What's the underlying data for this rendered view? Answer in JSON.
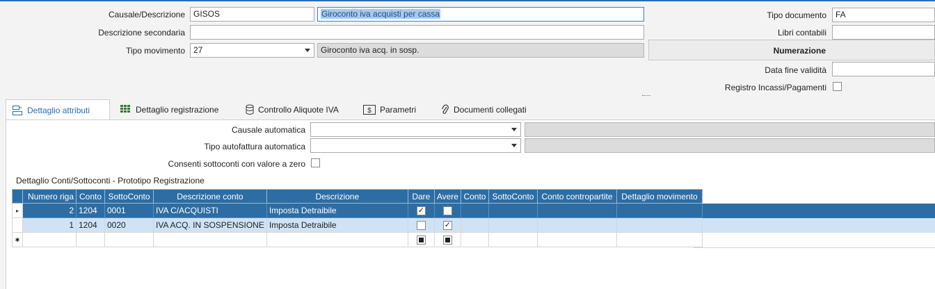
{
  "header": {
    "causale_label": "Causale/Descrizione",
    "causale_code": "GISOS",
    "causale_desc": "Giroconto iva acquisti per cassa",
    "desc_secondaria_label": "Descrizione secondaria",
    "desc_secondaria_value": "",
    "tipo_movimento_label": "Tipo movimento",
    "tipo_movimento_code": "27",
    "tipo_movimento_desc": "Giroconto iva acq. in sosp.",
    "tipo_documento_label": "Tipo documento",
    "tipo_documento_value": "FA",
    "libri_contabili_label": "Libri contabili",
    "libri_contabili_value": "",
    "numerazione_label": "Numerazione",
    "data_fine_label": "Data fine validità",
    "data_fine_value": "",
    "registro_label": "Registro Incassi/Pagamenti"
  },
  "tabs": [
    {
      "label": "Dettaglio attributi",
      "icon": "attributes-icon",
      "active": true
    },
    {
      "label": "Dettaglio registrazione",
      "icon": "grid-icon",
      "active": false
    },
    {
      "label": "Controllo Aliquote IVA",
      "icon": "coins-icon",
      "active": false
    },
    {
      "label": "Parametri",
      "icon": "parameters-icon",
      "active": false
    },
    {
      "label": "Documenti collegati",
      "icon": "paperclip-icon",
      "active": false
    }
  ],
  "attributi": {
    "causale_automatica_label": "Causale automatica",
    "causale_automatica_value": "",
    "tipo_autofattura_label": "Tipo autofattura automatica",
    "tipo_autofattura_value": "",
    "consenti_label": "Consenti sottoconti con valore a zero"
  },
  "grid": {
    "title": "Dettaglio Conti/Sottoconti - Prototipo Registrazione",
    "columns": [
      "Numero riga",
      "Conto",
      "SottoConto",
      "Descrizione conto",
      "Descrizione",
      "Dare",
      "Avere",
      "Conto",
      "SottoConto",
      "Conto contropartite",
      "Dettaglio movimento"
    ],
    "rows": [
      {
        "numero": "2",
        "conto": "1204",
        "sottoconto": "0001",
        "desc_conto": "IVA C/ACQUISTI",
        "descrizione": "Imposta Detraibile",
        "dare": true,
        "avere": false
      },
      {
        "numero": "1",
        "conto": "1204",
        "sottoconto": "0020",
        "desc_conto": "IVA ACQ. IN SOSPENSIONE",
        "descrizione": "Imposta Detraibile",
        "dare": false,
        "avere": true
      }
    ],
    "row_indicator_selected": "▸",
    "row_indicator_new": "✱"
  },
  "colors": {
    "accent": "#2b6cb0",
    "grid_header": "#2d6da3",
    "grid_selected": "#2d6da3",
    "grid_alt": "#cfe3f5"
  }
}
